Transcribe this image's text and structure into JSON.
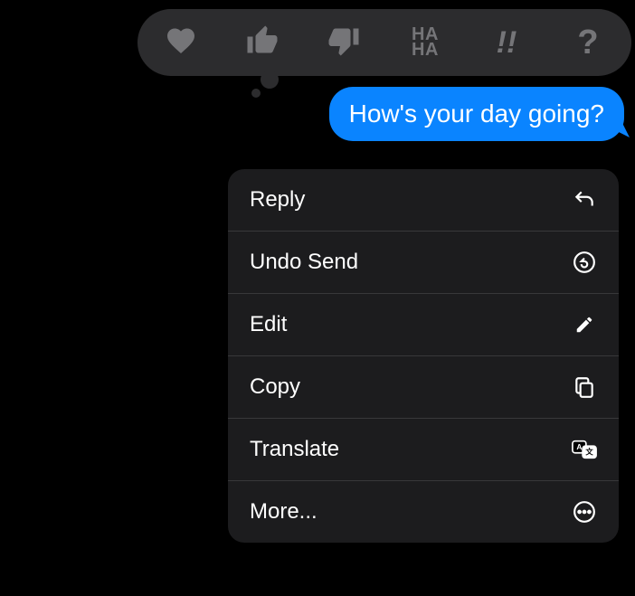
{
  "message": {
    "text": "How's your day going?"
  },
  "reactions": {
    "heart": "heart",
    "thumbs_up": "thumbs-up",
    "thumbs_down": "thumbs-down",
    "haha_line1": "HA",
    "haha_line2": "HA",
    "exclaim": "!!",
    "question": "?"
  },
  "menu": {
    "reply": "Reply",
    "undo_send": "Undo Send",
    "edit": "Edit",
    "copy": "Copy",
    "translate": "Translate",
    "more": "More..."
  }
}
